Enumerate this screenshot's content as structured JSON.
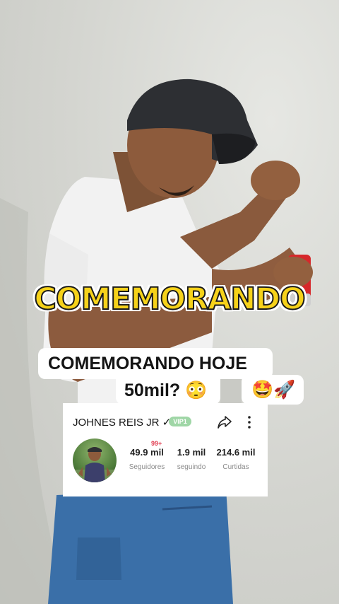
{
  "overlay": {
    "headline": "COMEMORANDO",
    "caption_line1": "COMEMORANDO HOJE",
    "caption_line2": "50mil? 😳",
    "caption_emojis": "🤩🚀"
  },
  "profile": {
    "username": "JOHNES REIS JR ✓",
    "vip_badge": "VIP1",
    "notification_badge": "99+",
    "stats": [
      {
        "value": "49.9 mil",
        "label": "Seguidores"
      },
      {
        "value": "1.9 mil",
        "label": "seguindo"
      },
      {
        "value": "214.6 mil",
        "label": "Curtidas"
      }
    ],
    "icons": [
      "share-icon",
      "more-vertical-icon"
    ]
  },
  "colors": {
    "headline_fill": "#f6d21a",
    "caption_bg": "#ffffff",
    "vip_green": "#9fd6a6",
    "badge_red": "#e0394d"
  }
}
